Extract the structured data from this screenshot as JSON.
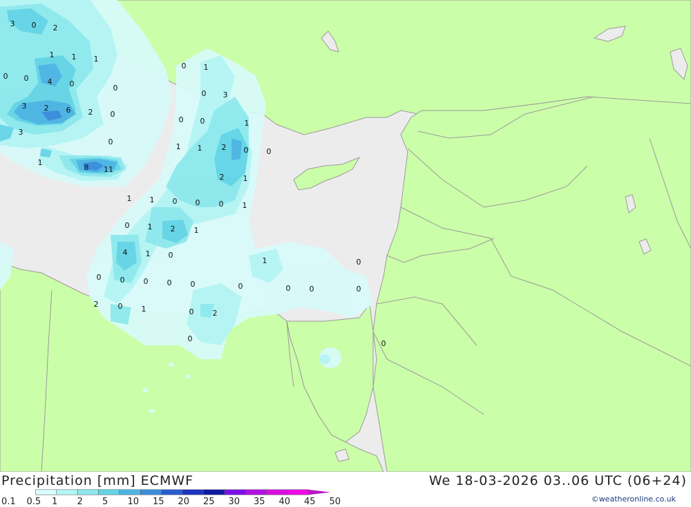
{
  "title": "Precipitation [mm] ECMWF",
  "valid_time": "We 18-03-2026 03..06 UTC (06+24)",
  "credit": "©weatheronline.co.uk",
  "colors": {
    "land": "#cbfea8",
    "sea": "#ececec",
    "border": "#9a9a9a",
    "label_text": "#111111"
  },
  "legend": {
    "labels": [
      "0.1",
      "0.5",
      "1",
      "2",
      "5",
      "10",
      "15",
      "20",
      "25",
      "30",
      "35",
      "40",
      "45",
      "50"
    ],
    "colors": [
      "#d8fbfb",
      "#b4f4f4",
      "#8ce8ec",
      "#64d4e6",
      "#4eb4e4",
      "#3c8cdc",
      "#2a5cd2",
      "#1c34c0",
      "#0e1aa0",
      "#7c10e8",
      "#b010e0",
      "#d80ee0",
      "#f00ae8",
      "#b818c4"
    ]
  },
  "values": [
    "3",
    "0",
    "2",
    "1",
    "1",
    "1",
    "0",
    "4",
    "0",
    "0",
    "3",
    "2",
    "6",
    "2",
    "0",
    "3",
    "0",
    "1",
    "8",
    "11",
    "0",
    "1",
    "0",
    "0",
    "3",
    "1",
    "0",
    "0",
    "2",
    "0",
    "0",
    "1",
    "1",
    "2",
    "1",
    "0",
    "1",
    "1",
    "1",
    "0",
    "0",
    "0",
    "1",
    "2",
    "1",
    "4",
    "1",
    "0",
    "1",
    "0",
    "0",
    "0",
    "0",
    "0",
    "0",
    "0",
    "0",
    "0",
    "0",
    "2",
    "0",
    "1",
    "0",
    "2",
    "0",
    "0"
  ]
}
